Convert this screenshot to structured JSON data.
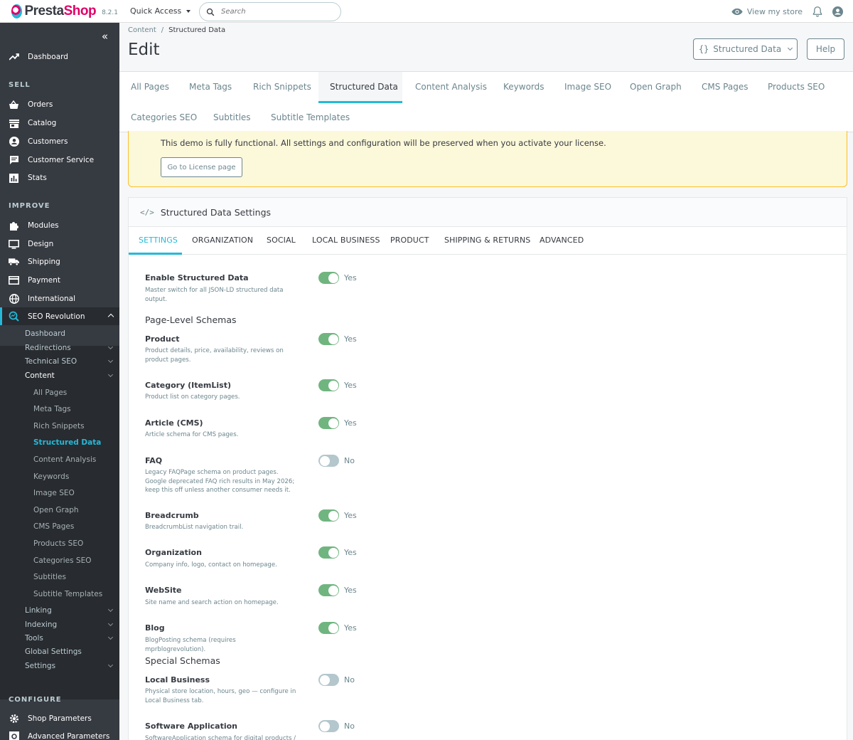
{
  "header": {
    "brand_a": "Presta",
    "brand_b": "Shop",
    "version": "8.2.1",
    "quick_access": "Quick Access",
    "search_placeholder": "Search",
    "view_store": "View my store"
  },
  "sidebar": {
    "top": [
      {
        "label": "Dashboard",
        "icon": "trending-up-icon"
      }
    ],
    "sell_title": "SELL",
    "sell": [
      {
        "label": "Orders",
        "icon": "basket-icon"
      },
      {
        "label": "Catalog",
        "icon": "store-icon"
      },
      {
        "label": "Customers",
        "icon": "account-icon"
      },
      {
        "label": "Customer Service",
        "icon": "chat-icon"
      },
      {
        "label": "Stats",
        "icon": "bar-chart-icon"
      }
    ],
    "improve_title": "IMPROVE",
    "improve": [
      {
        "label": "Modules",
        "icon": "puzzle-icon"
      },
      {
        "label": "Design",
        "icon": "desktop-icon"
      },
      {
        "label": "Shipping",
        "icon": "truck-icon"
      },
      {
        "label": "Payment",
        "icon": "credit-card-icon"
      },
      {
        "label": "International",
        "icon": "globe-icon"
      },
      {
        "label": "SEO Revolution",
        "icon": "seo-icon"
      }
    ],
    "seo_sub": [
      {
        "label": "Dashboard",
        "has_children": false
      },
      {
        "label": "Redirections",
        "has_children": true
      },
      {
        "label": "Technical SEO",
        "has_children": true
      },
      {
        "label": "Content",
        "has_children": true
      }
    ],
    "content_children": [
      "All Pages",
      "Meta Tags",
      "Rich Snippets",
      "Structured Data",
      "Content Analysis",
      "Keywords",
      "Image SEO",
      "Open Graph",
      "CMS Pages",
      "Products SEO",
      "Categories SEO",
      "Subtitles",
      "Subtitle Templates"
    ],
    "seo_sub_after": [
      {
        "label": "Linking",
        "has_children": true
      },
      {
        "label": "Indexing",
        "has_children": true
      },
      {
        "label": "Tools",
        "has_children": true
      },
      {
        "label": "Global Settings",
        "has_children": false
      },
      {
        "label": "Settings",
        "has_children": true
      }
    ],
    "configure_title": "CONFIGURE",
    "configure": [
      {
        "label": "Shop Parameters",
        "icon": "settings-icon"
      },
      {
        "label": "Advanced Parameters",
        "icon": "settings-applications-icon"
      }
    ]
  },
  "breadcrumb": {
    "parent": "Content",
    "separator": "/",
    "current": "Structured Data"
  },
  "page": {
    "title": "Edit",
    "dropdown_label": "Structured Data",
    "help_label": "Help"
  },
  "tabs": [
    "All Pages",
    "Meta Tags",
    "Rich Snippets",
    "Structured Data",
    "Content Analysis",
    "Keywords",
    "Image SEO",
    "Open Graph",
    "CMS Pages",
    "Products SEO",
    "Categories SEO",
    "Subtitles",
    "Subtitle Templates"
  ],
  "alert": {
    "text": "This demo is fully functional. All settings and configuration will be preserved when you activate your license.",
    "button": "Go to License page"
  },
  "card": {
    "title": "Structured Data Settings",
    "subtabs": [
      "SETTINGS",
      "ORGANIZATION",
      "SOCIAL",
      "LOCAL BUSINESS",
      "PRODUCT",
      "SHIPPING & RETURNS",
      "ADVANCED"
    ]
  },
  "settings": {
    "master": {
      "label": "Enable Structured Data",
      "help": "Master switch for all JSON-LD structured data output.",
      "enabled": true,
      "state_text": "Yes"
    },
    "page_level_title": "Page-Level Schemas",
    "page_level": [
      {
        "label": "Product",
        "help": "Product details, price, availability, reviews on product pages.",
        "enabled": true,
        "state_text": "Yes"
      },
      {
        "label": "Category (ItemList)",
        "help": "Product list on category pages.",
        "enabled": true,
        "state_text": "Yes"
      },
      {
        "label": "Article (CMS)",
        "help": "Article schema for CMS pages.",
        "enabled": true,
        "state_text": "Yes"
      },
      {
        "label": "FAQ",
        "help": "Legacy FAQPage schema on product pages. Google deprecated FAQ rich results in May 2026; keep this off unless another consumer needs it.",
        "enabled": false,
        "state_text": "No"
      },
      {
        "label": "Breadcrumb",
        "help": "BreadcrumbList navigation trail.",
        "enabled": true,
        "state_text": "Yes"
      },
      {
        "label": "Organization",
        "help": "Company info, logo, contact on homepage.",
        "enabled": true,
        "state_text": "Yes"
      },
      {
        "label": "WebSite",
        "help": "Site name and search action on homepage.",
        "enabled": true,
        "state_text": "Yes"
      },
      {
        "label": "Blog",
        "help": "BlogPosting schema (requires mprblogrevolution).",
        "enabled": true,
        "state_text": "Yes"
      }
    ],
    "special_title": "Special Schemas",
    "special": [
      {
        "label": "Local Business",
        "help": "Physical store location, hours, geo — configure in Local Business tab.",
        "enabled": false,
        "state_text": "No"
      },
      {
        "label": "Software Application",
        "help": "SoftwareApplication schema for digital products /",
        "enabled": false,
        "state_text": "No"
      }
    ]
  },
  "colors": {
    "accent": "#25b9d7",
    "brand": "#df0067",
    "sidebar_bg": "#363a41",
    "switch_on": "#70b580",
    "switch_off": "#b3c7cd",
    "alert_bg": "#fcf8da",
    "alert_border": "#fbc02d"
  }
}
